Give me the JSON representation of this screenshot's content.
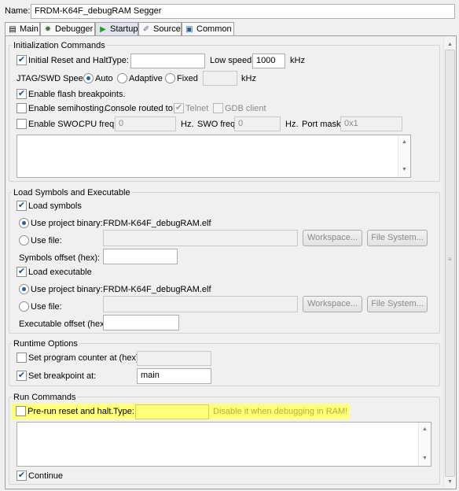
{
  "name_label": "Name:",
  "name_value": "FRDM-K64F_debugRAM Segger",
  "tabs": [
    {
      "label": "Main",
      "icon": "main-tab-icon"
    },
    {
      "label": "Debugger",
      "icon": "debugger-tab-icon"
    },
    {
      "label": "Startup",
      "icon": "startup-tab-icon"
    },
    {
      "label": "Source",
      "icon": "source-tab-icon"
    },
    {
      "label": "Common",
      "icon": "common-tab-icon"
    }
  ],
  "init": {
    "title": "Initialization Commands",
    "reset_label": "Initial Reset and Halt.",
    "type_label": "Type:",
    "type_value": "",
    "low_speed_label": "Low speed:",
    "low_speed_value": "1000",
    "khz": "kHz",
    "jtag_label": "JTAG/SWD Speed:",
    "auto_label": "Auto",
    "adaptive_label": "Adaptive",
    "fixed_label": "Fixed",
    "fixed_value": "",
    "flash_label": "Enable flash breakpoints.",
    "semihost_label": "Enable semihosting.",
    "console_label": "Console routed to:",
    "telnet_label": "Telnet",
    "gdb_label": "GDB client",
    "swo_label": "Enable SWO.",
    "cpu_freq_label": "CPU freq:",
    "cpu_freq_value": "0",
    "hz": "Hz.",
    "swo_freq_label": "SWO freq:",
    "swo_freq_value": "0",
    "port_mask_label": "Port mask:",
    "port_mask_value": "0x1"
  },
  "load": {
    "title": "Load Symbols and Executable",
    "load_symbols_label": "Load symbols",
    "use_project_label": "Use project binary:",
    "symbols_binary": "FRDM-K64F_debugRAM.elf",
    "use_file_label": "Use file:",
    "workspace_label": "Workspace...",
    "filesystem_label": "File System...",
    "symbols_offset_label": "Symbols offset (hex):",
    "load_exec_label": "Load executable",
    "exec_binary": "FRDM-K64F_debugRAM.elf",
    "exec_offset_label": "Executable offset (hex):"
  },
  "runtime": {
    "title": "Runtime Options",
    "pc_label": "Set program counter at (hex):",
    "bp_label": "Set breakpoint at:",
    "bp_value": "main"
  },
  "run": {
    "title": "Run Commands",
    "prerun_label": "Pre-run reset and halt.",
    "type_label": "Type:",
    "hint": "Disable it when debugging in RAM!",
    "continue_label": "Continue"
  },
  "colors": {
    "highlight": "#ffff7a",
    "accent": "#1e5fb0"
  }
}
